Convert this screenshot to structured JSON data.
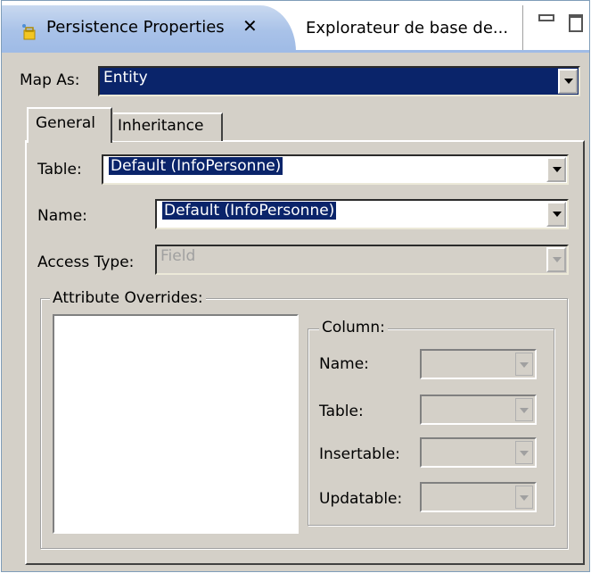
{
  "view": {
    "active_tab": "Persistence Properties",
    "inactive_tab": "Explorateur de base de..."
  },
  "map_as": {
    "label": "Map As:",
    "value": "Entity"
  },
  "tabs": [
    {
      "label": "General",
      "selected": true
    },
    {
      "label": "Inheritance",
      "selected": false
    }
  ],
  "general": {
    "table": {
      "label": "Table:",
      "value": "Default (InfoPersonne)"
    },
    "name": {
      "label": "Name:",
      "value": "Default (InfoPersonne)"
    },
    "access_type": {
      "label": "Access Type:",
      "value": "Field",
      "enabled": false
    }
  },
  "attribute_overrides": {
    "title": "Attribute Overrides:",
    "items": [],
    "column": {
      "title": "Column:",
      "fields": [
        {
          "label": "Name:",
          "value": ""
        },
        {
          "label": "Table:",
          "value": ""
        },
        {
          "label": "Insertable:",
          "value": ""
        },
        {
          "label": "Updatable:",
          "value": ""
        }
      ]
    }
  },
  "icons": {
    "tab": "persistence-icon",
    "close": "close-icon",
    "minimize": "minimize-icon",
    "maximize": "maximize-icon",
    "dropdown": "chevron-down-icon"
  },
  "colors": {
    "selection": "#0a246a",
    "panel": "#d4d0c8",
    "active_tab": "#a9c2e8"
  }
}
